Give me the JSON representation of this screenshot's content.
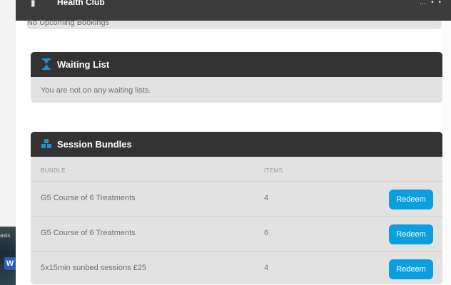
{
  "header": {
    "brand": "Health Club",
    "corner_text": "… • •"
  },
  "bookings": {
    "message": "No Upcoming Bookings"
  },
  "waiting_list": {
    "title": "Waiting List",
    "message": "You are not on any waiting lists."
  },
  "session_bundles": {
    "title": "Session Bundles",
    "columns": {
      "bundle": "BUNDLE",
      "items": "ITEMS"
    },
    "rows": [
      {
        "name": "G5 Course of 6 Treatments",
        "items": "4",
        "action": "Redeem"
      },
      {
        "name": "G5 Course of 6 Treatments",
        "items": "6",
        "action": "Redeem"
      },
      {
        "name": "5x15min sunbed sessions £25",
        "items": "4",
        "action": "Redeem"
      }
    ]
  },
  "taskbar": {
    "snippet": "asis",
    "word_letter": "W"
  },
  "colors": {
    "header_bg": "#333333",
    "card_bg": "#e2e2e2",
    "accent": "#0c9fe0",
    "icon_blue": "#1e90d6"
  },
  "icons": {
    "waiting_list": "hourglass-icon",
    "session_bundles": "stacked-boxes-icon"
  }
}
